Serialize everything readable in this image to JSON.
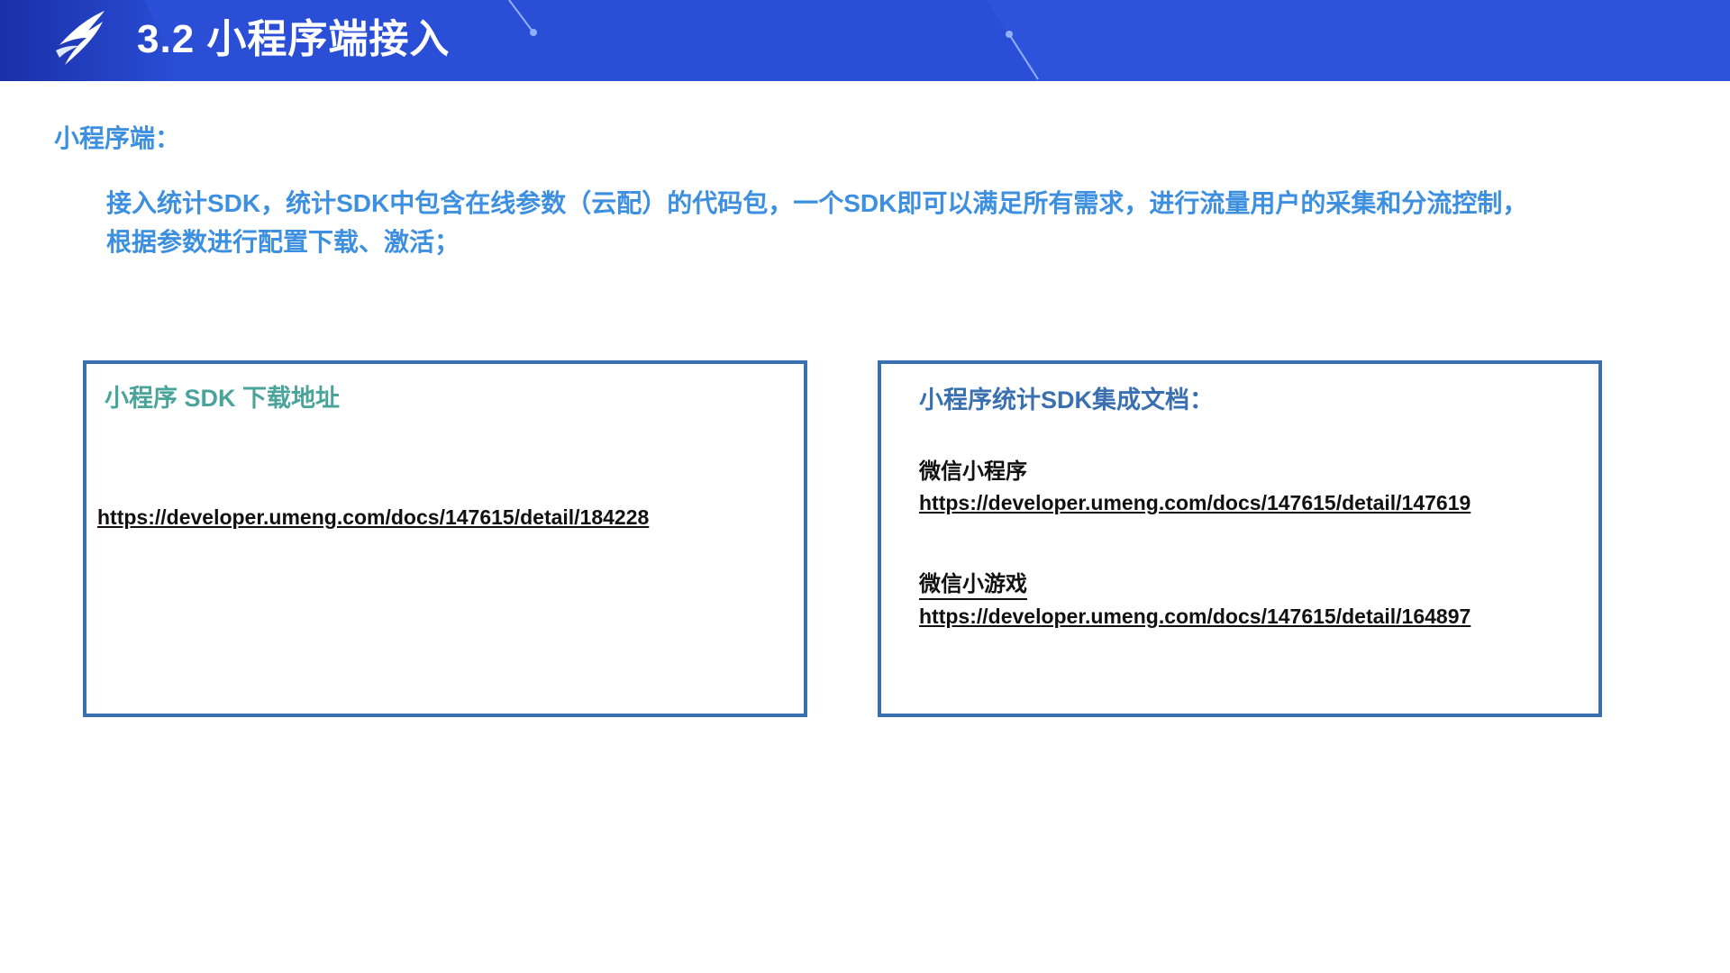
{
  "header": {
    "title": "3.2 小程序端接入",
    "logo_icon": "swift-bird-logo-icon",
    "background_color": "#2a4fd6"
  },
  "section": {
    "label": "小程序端：",
    "description": "接入统计SDK，统计SDK中包含在线参数（云配）的代码包，一个SDK即可以满足所有需求，进行流量用户的采集和分流控制，根据参数进行配置下载、激活；",
    "text_color": "#3d8fe0"
  },
  "left_box": {
    "title": "小程序 SDK 下载地址",
    "link": "https://developer.umeng.com/docs/147615/detail/184228",
    "title_color": "#4aa49a",
    "border_color": "#3a6fb0"
  },
  "right_box": {
    "title": "小程序统计SDK集成文档：",
    "items": [
      {
        "label": "微信小程序",
        "link": "https://developer.umeng.com/docs/147615/detail/147619"
      },
      {
        "label": "微信小游戏",
        "link": "https://developer.umeng.com/docs/147615/detail/164897"
      }
    ],
    "title_color": "#3a6fb0",
    "border_color": "#3a6fb0"
  }
}
